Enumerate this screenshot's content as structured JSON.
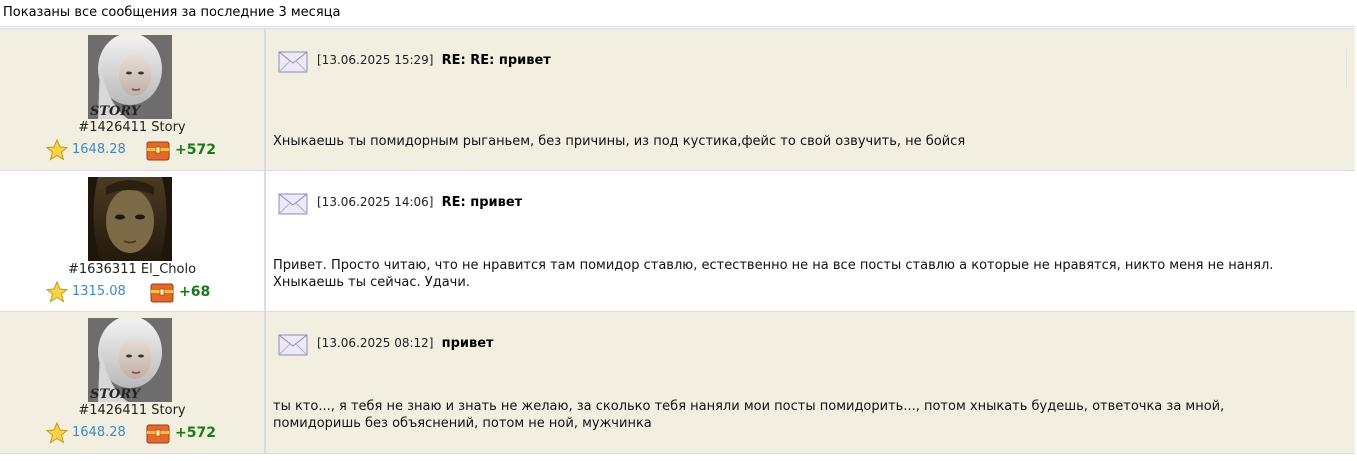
{
  "header": {
    "text": "Показаны все сообщения за последние 3 месяца"
  },
  "messages": [
    {
      "user": {
        "id_name": "#1426411 Story",
        "rating": "1648.28",
        "karma": "+572",
        "avatar": "story-avatar"
      },
      "date": "[13.06.2025 15:29]",
      "subject": "RE: RE: привет",
      "text": "Хныкаешь ты помидорным рыганьем, без причины, из под кустика,фейс то свой озвучить, не бойся"
    },
    {
      "user": {
        "id_name": "#1636311 El_Cholo",
        "rating": "1315.08",
        "karma": "+68",
        "avatar": "el-cholo-avatar"
      },
      "date": "[13.06.2025 14:06]",
      "subject": "RE: привет",
      "text": "Привет. Просто читаю, что не нравится там помидор ставлю, естественно не на все посты ставлю а которые не нравятся, никто меня не нанял. Хныкаешь ты сейчас. Удачи."
    },
    {
      "user": {
        "id_name": "#1426411 Story",
        "rating": "1648.28",
        "karma": "+572",
        "avatar": "story-avatar"
      },
      "date": "[13.06.2025 08:12]",
      "subject": "привет",
      "text": "ты кто..., я тебя не знаю и знать не желаю, за сколько тебя наняли мои посты помидорить..., потом хныкать будешь, ответочка за мной, помидоришь без объяснений, потом не ной, мужчинка"
    }
  ],
  "icons": {
    "rating": "star-icon",
    "karma": "chest-icon",
    "message": "envelope-icon"
  },
  "colors": {
    "row_alt": "#f3efe0",
    "rating": "#3f88c5",
    "karma": "#1a7a1a",
    "border": "#d6dde8"
  }
}
